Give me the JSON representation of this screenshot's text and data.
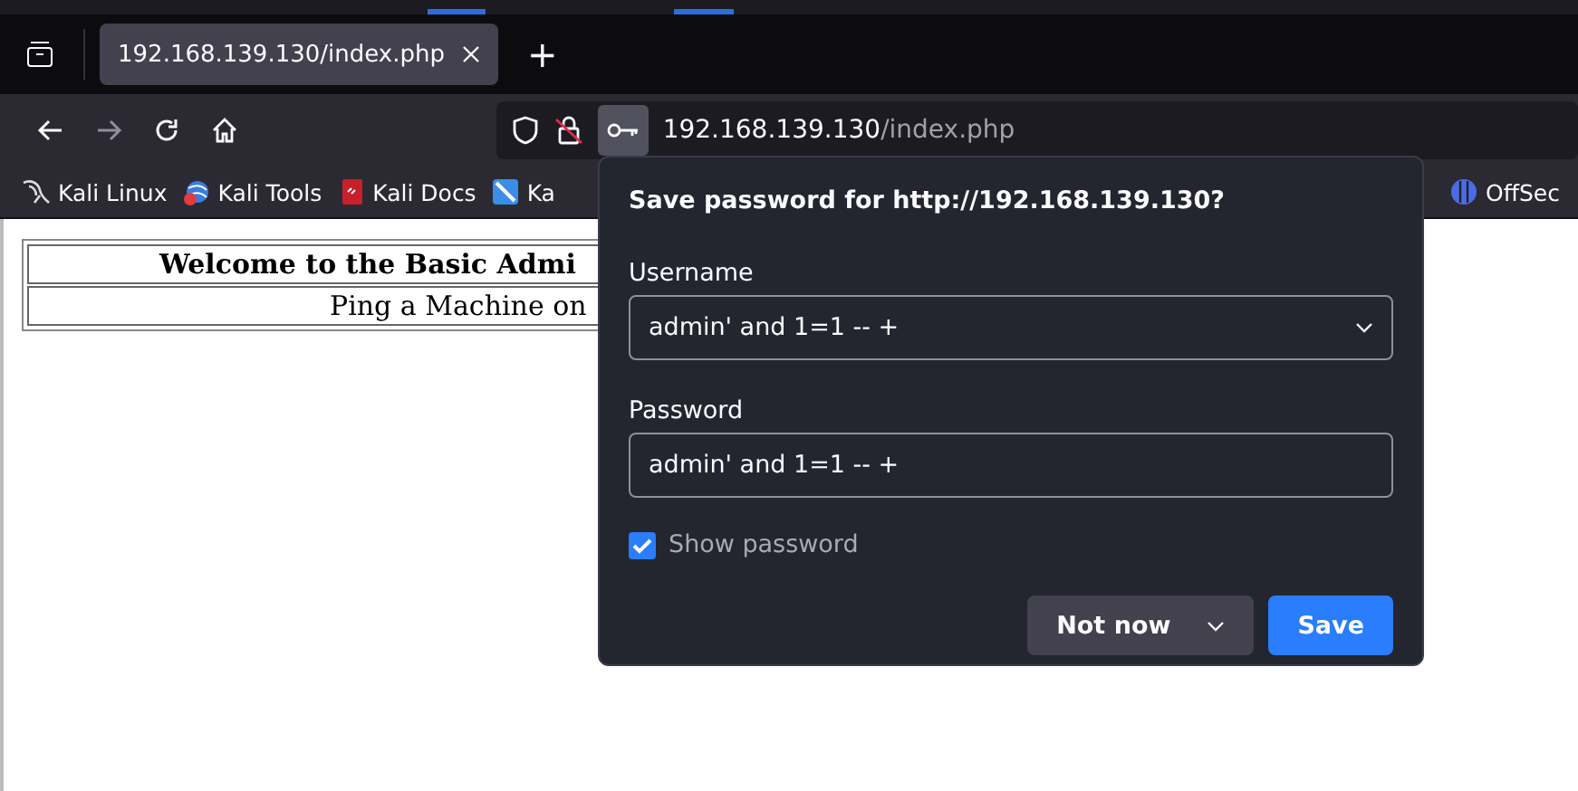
{
  "tab_bar": {
    "tabs": [
      {
        "title": "192.168.139.130/index.php",
        "selected": true
      }
    ],
    "new_tab": "+"
  },
  "address_bar": {
    "host": "192.168.139.130",
    "path": "/index.php"
  },
  "bookmarks": [
    {
      "label": "Kali Linux"
    },
    {
      "label": "Kali Tools"
    },
    {
      "label": "Kali Docs"
    },
    {
      "label": "Ka"
    },
    {
      "label": "OffSec"
    }
  ],
  "page": {
    "heading": "Welcome to the Basic Admi",
    "subheading": "Ping a Machine on"
  },
  "popup": {
    "title": "Save password for http://192.168.139.130?",
    "username": {
      "label": "Username",
      "value": "admin' and 1=1 -- +"
    },
    "password": {
      "label": "Password",
      "value": "admin' and 1=1 -- +"
    },
    "show_password": {
      "label": "Show password",
      "checked": true
    },
    "buttons": [
      {
        "label": "Not now",
        "kind": "secondary"
      },
      {
        "label": "Save",
        "kind": "primary"
      }
    ]
  }
}
